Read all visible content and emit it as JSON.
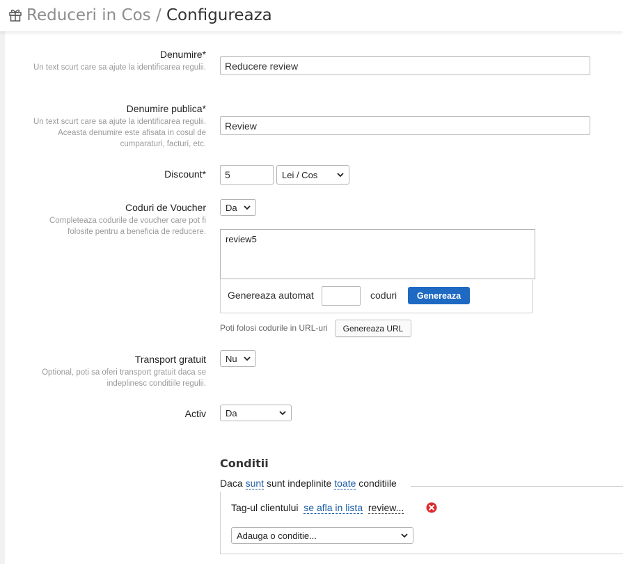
{
  "header": {
    "icon": "gift-icon",
    "breadcrumb_parent": "Reduceri in Cos",
    "separator": "/",
    "current": "Configureaza"
  },
  "form": {
    "name": {
      "label": "Denumire*",
      "hint": "Un text scurt care sa ajute la identificarea regulii.",
      "value": "Reducere review"
    },
    "public_name": {
      "label": "Denumire publica*",
      "hint": "Un text scurt care sa ajute la identificarea regulii. Aceasta denumire este afisata in cosul de cumparaturi, facturi, etc.",
      "value": "Review"
    },
    "discount": {
      "label": "Discount*",
      "value": "5",
      "unit": "Lei / Cos"
    },
    "vouchers": {
      "label": "Coduri de Voucher",
      "hint": "Completeaza codurile de voucher care pot fi folosite pentru a beneficia de reducere.",
      "enabled": "Da",
      "codes": "review5",
      "generate_prefix": "Genereaza automat",
      "generate_count": "",
      "generate_suffix": "coduri",
      "generate_button": "Genereaza",
      "url_hint": "Poti folosi codurile in URL-uri",
      "url_button": "Genereaza URL"
    },
    "free_shipping": {
      "label": "Transport gratuit",
      "hint": "Optional, poti sa oferi transport gratuit daca se indeplinesc conditiile regulii.",
      "value": "Nu"
    },
    "active": {
      "label": "Activ",
      "value": "Da"
    }
  },
  "conditions": {
    "title": "Conditii",
    "prefix": "Daca",
    "mode": "sunt",
    "middle": "sunt indeplinite",
    "scope": "toate",
    "suffix": "conditiile",
    "items": [
      {
        "subject": "Tag-ul clientului",
        "operator": "se afla in lista",
        "value": "review..."
      }
    ],
    "add_placeholder": "Adauga o conditie..."
  },
  "colors": {
    "primary": "#1e6ac3",
    "link": "#1e5fa8",
    "remove": "#e0282d"
  }
}
